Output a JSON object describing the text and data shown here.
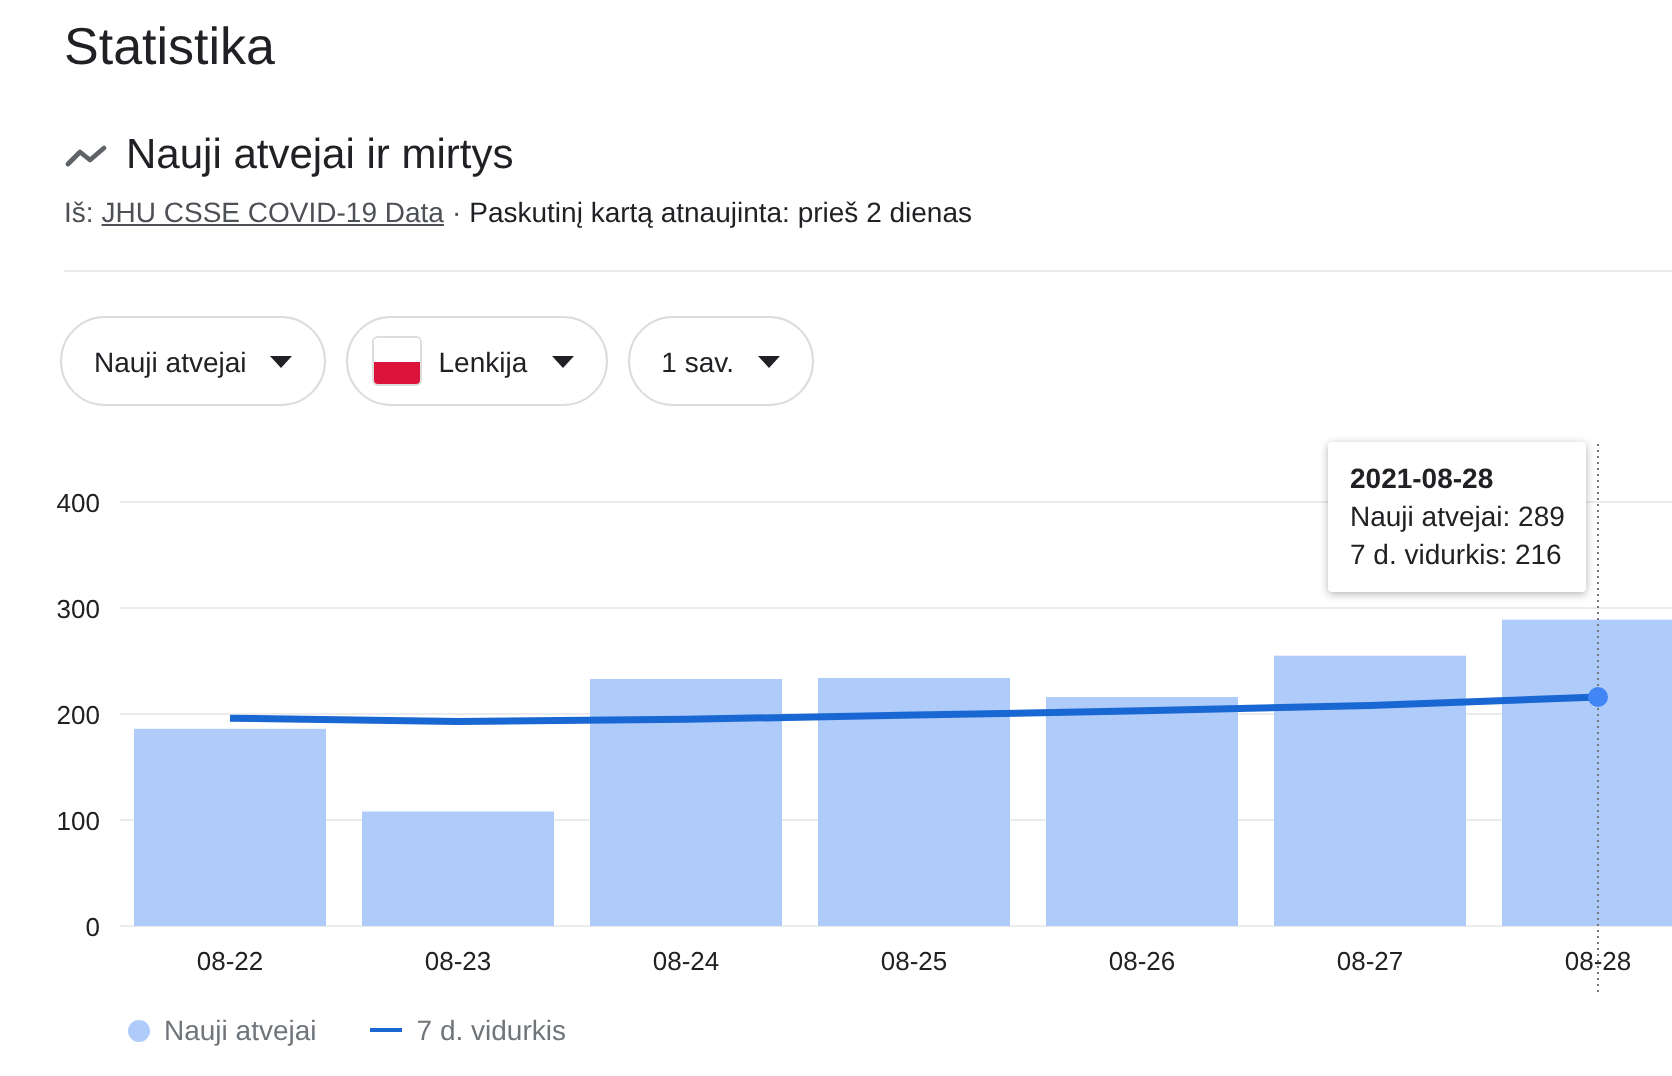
{
  "page_title": "Statistika",
  "section": {
    "title": "Nauji atvejai ir mirtys",
    "source_label": "Iš:",
    "source_link": "JHU CSSE COVID-19 Data",
    "separator": "·",
    "updated": "Paskutinį kartą atnaujinta: prieš 2 dienas"
  },
  "filters": [
    {
      "label": "Nauji atvejai",
      "kind": "plain"
    },
    {
      "label": "Lenkija",
      "kind": "flag"
    },
    {
      "label": "1 sav.",
      "kind": "plain"
    }
  ],
  "tooltip": {
    "title": "2021-08-28",
    "lines": [
      "Nauji atvejai: 289",
      "7 d. vidurkis: 216"
    ]
  },
  "chart_data": {
    "type": "bar",
    "categories": [
      "08-22",
      "08-23",
      "08-24",
      "08-25",
      "08-26",
      "08-27",
      "08-28"
    ],
    "series": [
      {
        "name": "Nauji atvejai",
        "type": "bar",
        "color": "#aecbfa",
        "values": [
          186,
          108,
          233,
          234,
          216,
          255,
          289
        ]
      },
      {
        "name": "7 d. vidurkis",
        "type": "line",
        "color": "#1967d2",
        "values": [
          196,
          193,
          195,
          199,
          203,
          208,
          216
        ]
      }
    ],
    "stacked": false,
    "grid": true,
    "ref_lines": [
      {
        "axis": "x",
        "value": "08-28"
      }
    ],
    "ylim": [
      0,
      400
    ],
    "yticks": [
      0,
      100,
      200,
      300,
      400
    ]
  }
}
